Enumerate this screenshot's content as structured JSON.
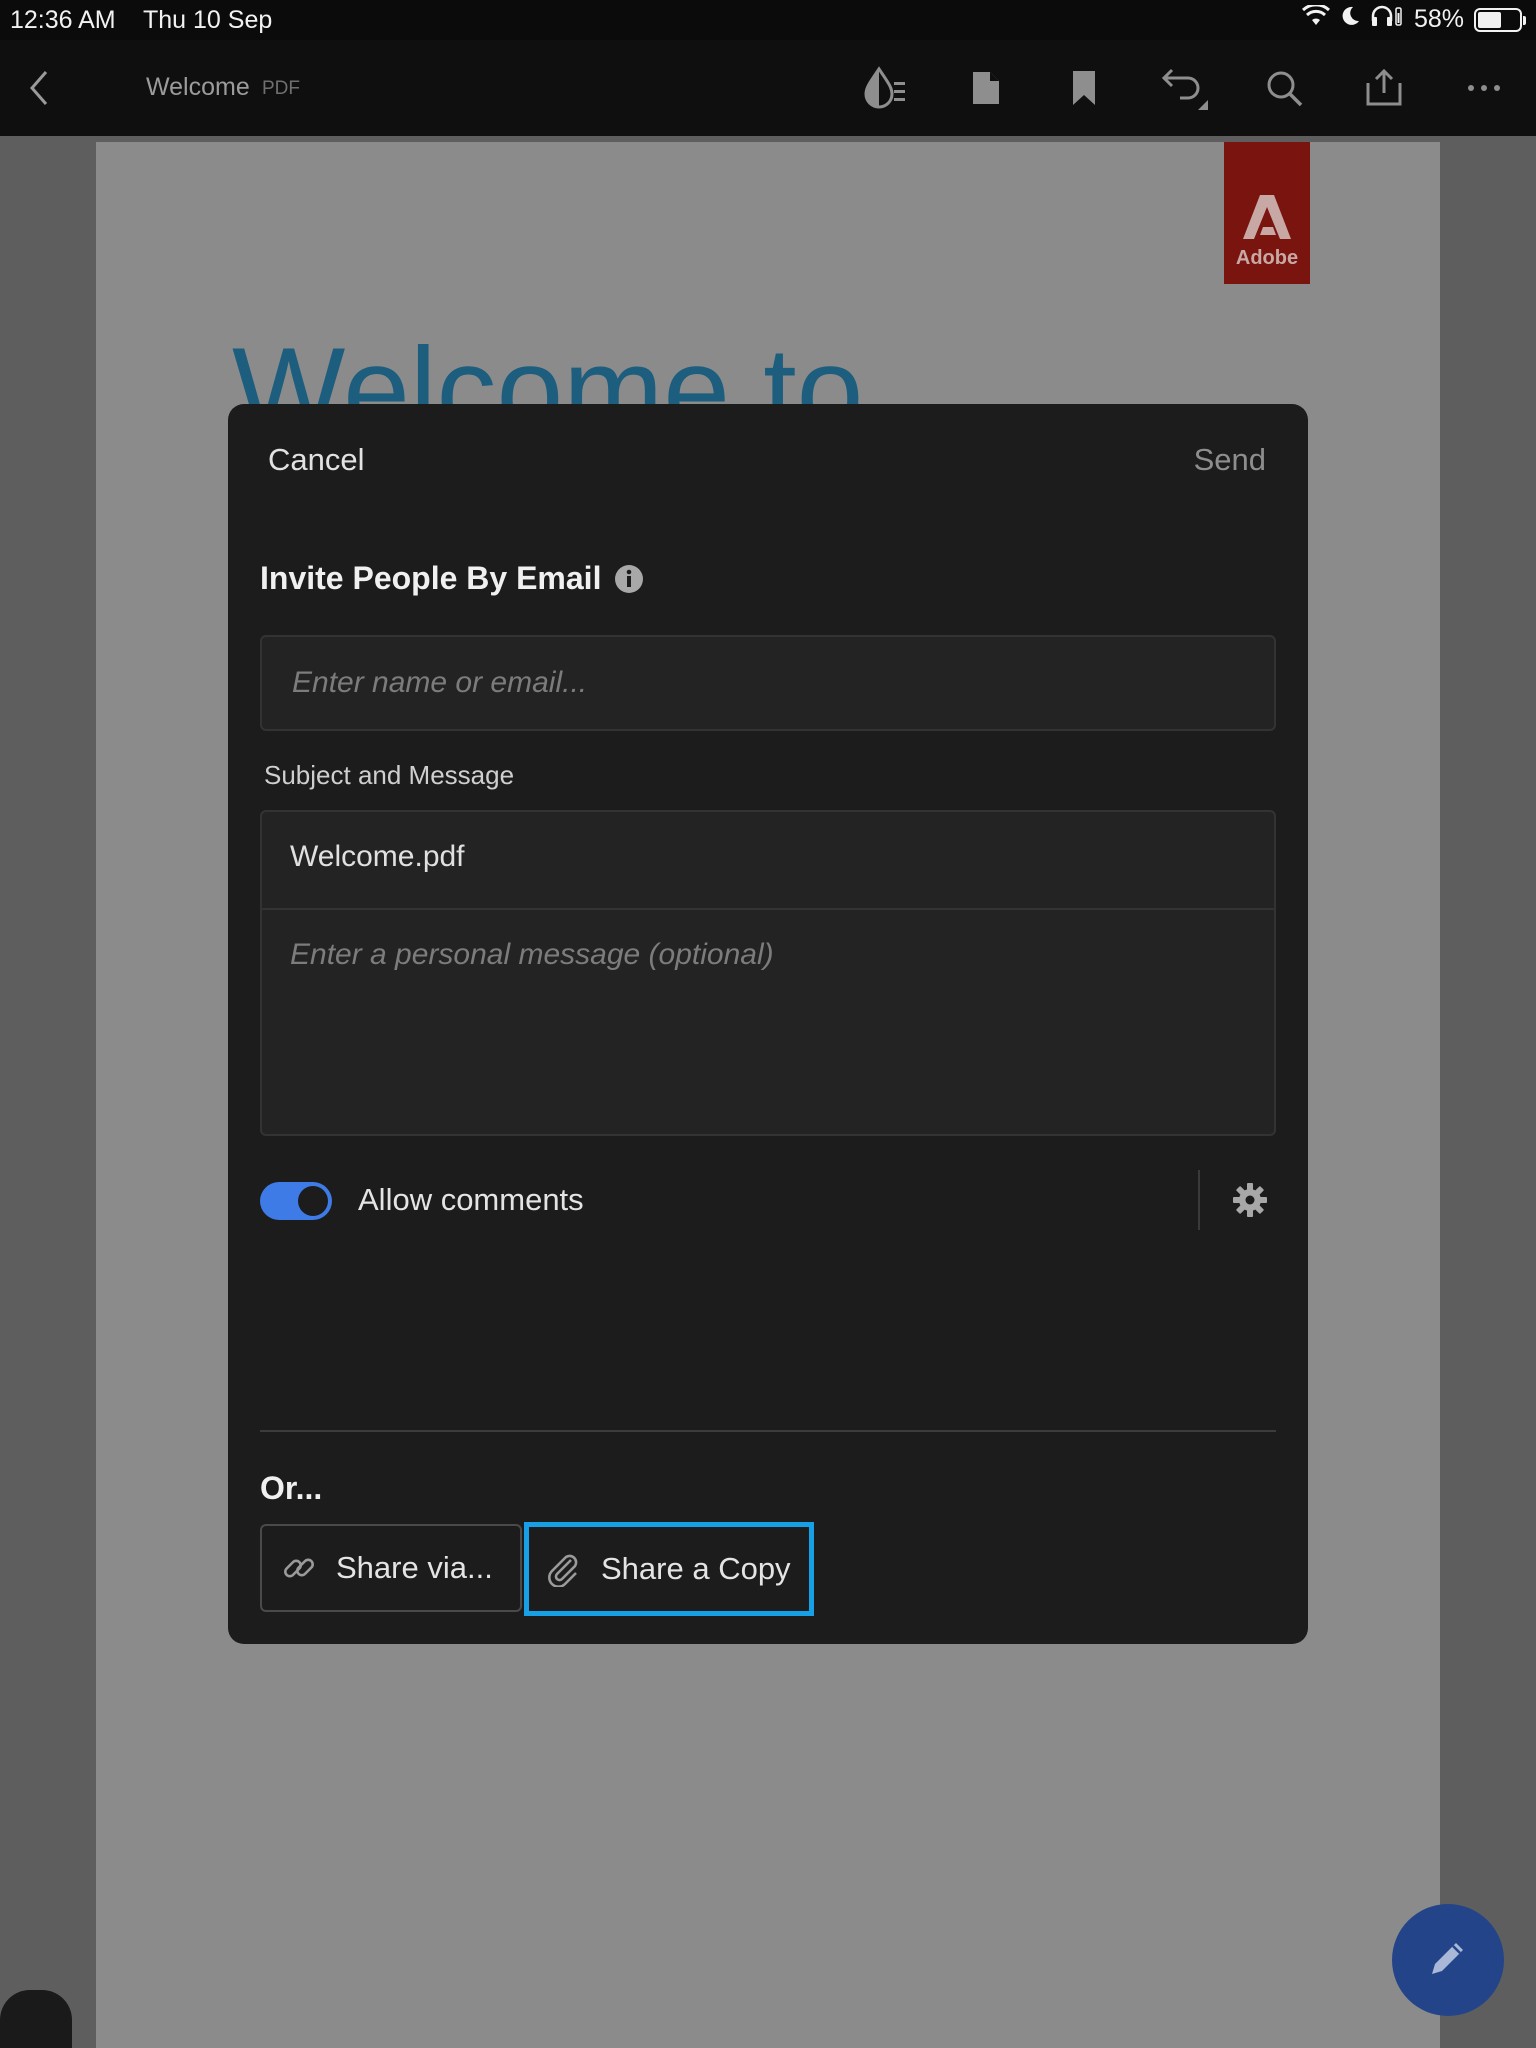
{
  "status_bar": {
    "time": "12:36 AM",
    "date": "Thu 10 Sep",
    "battery_percent": "58%",
    "battery_level": 0.58,
    "icons": [
      "wifi-icon",
      "moon-icon",
      "headphones-icon",
      "battery-icon"
    ]
  },
  "toolbar": {
    "doc_title": "Welcome",
    "doc_type": "PDF",
    "icons": [
      "back-icon",
      "liquid-mode-icon",
      "page-icon",
      "bookmark-icon",
      "undo-icon",
      "search-icon",
      "share-icon",
      "more-icon"
    ]
  },
  "document": {
    "logo_text": "Adobe",
    "heading": "Welcome to"
  },
  "dialog": {
    "cancel_label": "Cancel",
    "send_label": "Send",
    "invite_title": "Invite People By Email",
    "email_placeholder": "Enter name or email...",
    "subject_label": "Subject and Message",
    "subject_value": "Welcome.pdf",
    "message_placeholder": "Enter a personal message (optional)",
    "allow_comments_label": "Allow comments",
    "allow_comments_on": true,
    "or_label": "Or...",
    "share_via_label": "Share via...",
    "share_copy_label": "Share a Copy"
  },
  "colors": {
    "accent_toggle": "#3f7be6",
    "highlight_border": "#18a0e6",
    "fab": "#24448a",
    "adobe_red": "#7a140f"
  }
}
